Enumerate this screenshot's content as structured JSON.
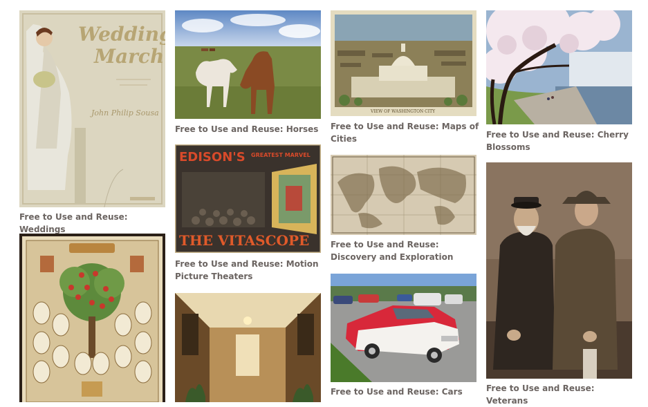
{
  "gallery": {
    "items": [
      {
        "caption": "Free to Use and Reuse: Weddings",
        "image_icon": "wedding-march-poster-image",
        "image_text": [
          "Wedding",
          "March",
          "John Philip Sousa"
        ]
      },
      {
        "caption": "Free to Use and Reuse: Horses",
        "image_icon": "horses-photo-image"
      },
      {
        "caption": "Free to Use and Reuse: Maps of Cities",
        "image_icon": "washington-city-map-image",
        "image_text": [
          "VIEW OF WASHINGTON CITY"
        ]
      },
      {
        "caption": "Free to Use and Reuse: Cherry Blossoms",
        "image_icon": "cherry-blossoms-photo-image"
      },
      {
        "caption": "Free to Use and Reuse: Discovery and Exploration",
        "image_icon": "world-map-image"
      },
      {
        "caption": "Free to Use and Reuse: Motion Picture Theaters",
        "image_icon": "vitascope-poster-image",
        "image_text": [
          "EDISON'S",
          "GREATEST MARVEL",
          "THE VITASCOPE"
        ]
      },
      {
        "caption": "Free to Use and Reuse: Cars",
        "image_icon": "red-car-photo-image"
      },
      {
        "caption": "Free to Use and Reuse: Veterans",
        "image_icon": "veterans-photo-image"
      },
      {
        "caption": "",
        "image_icon": "family-tree-image"
      },
      {
        "caption": "",
        "image_icon": "hotel-hallway-image"
      }
    ]
  },
  "colors": {
    "caption": "#6b6461",
    "background": "#ffffff"
  }
}
